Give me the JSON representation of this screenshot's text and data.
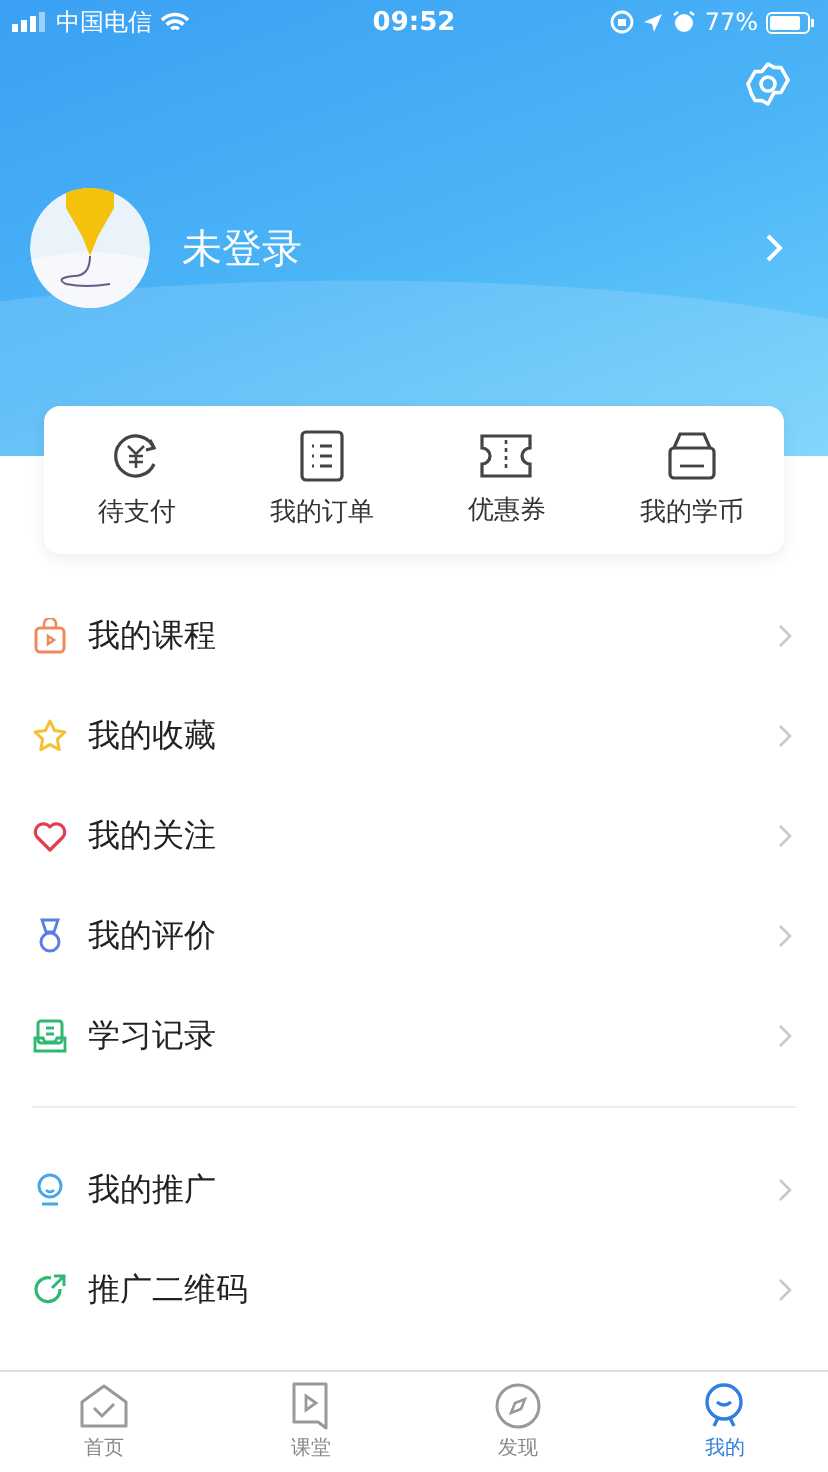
{
  "status_bar": {
    "carrier": "中国电信",
    "time": "09:52",
    "battery": "77%"
  },
  "profile": {
    "name": "未登录"
  },
  "shortcuts": [
    {
      "kind": "pay",
      "label": "待支付"
    },
    {
      "kind": "order",
      "label": "我的订单"
    },
    {
      "kind": "coupon",
      "label": "优惠券"
    },
    {
      "kind": "coin",
      "label": "我的学币"
    }
  ],
  "menu_groups": [
    [
      {
        "kind": "course",
        "label": "我的课程",
        "color": "#f08a5d"
      },
      {
        "kind": "favorite",
        "label": "我的收藏",
        "color": "#f2c230"
      },
      {
        "kind": "follow",
        "label": "我的关注",
        "color": "#e0404e"
      },
      {
        "kind": "review",
        "label": "我的评价",
        "color": "#5b7fe0"
      },
      {
        "kind": "record",
        "label": "学习记录",
        "color": "#2eb872"
      }
    ],
    [
      {
        "kind": "promote",
        "label": "我的推广",
        "color": "#4aa6e8"
      },
      {
        "kind": "qrcode",
        "label": "推广二维码",
        "color": "#2eb872"
      }
    ]
  ],
  "tabs": [
    {
      "kind": "home",
      "label": "首页",
      "selected": false
    },
    {
      "kind": "class",
      "label": "课堂",
      "selected": false
    },
    {
      "kind": "discover",
      "label": "发现",
      "selected": false
    },
    {
      "kind": "mine",
      "label": "我的",
      "selected": true
    }
  ]
}
